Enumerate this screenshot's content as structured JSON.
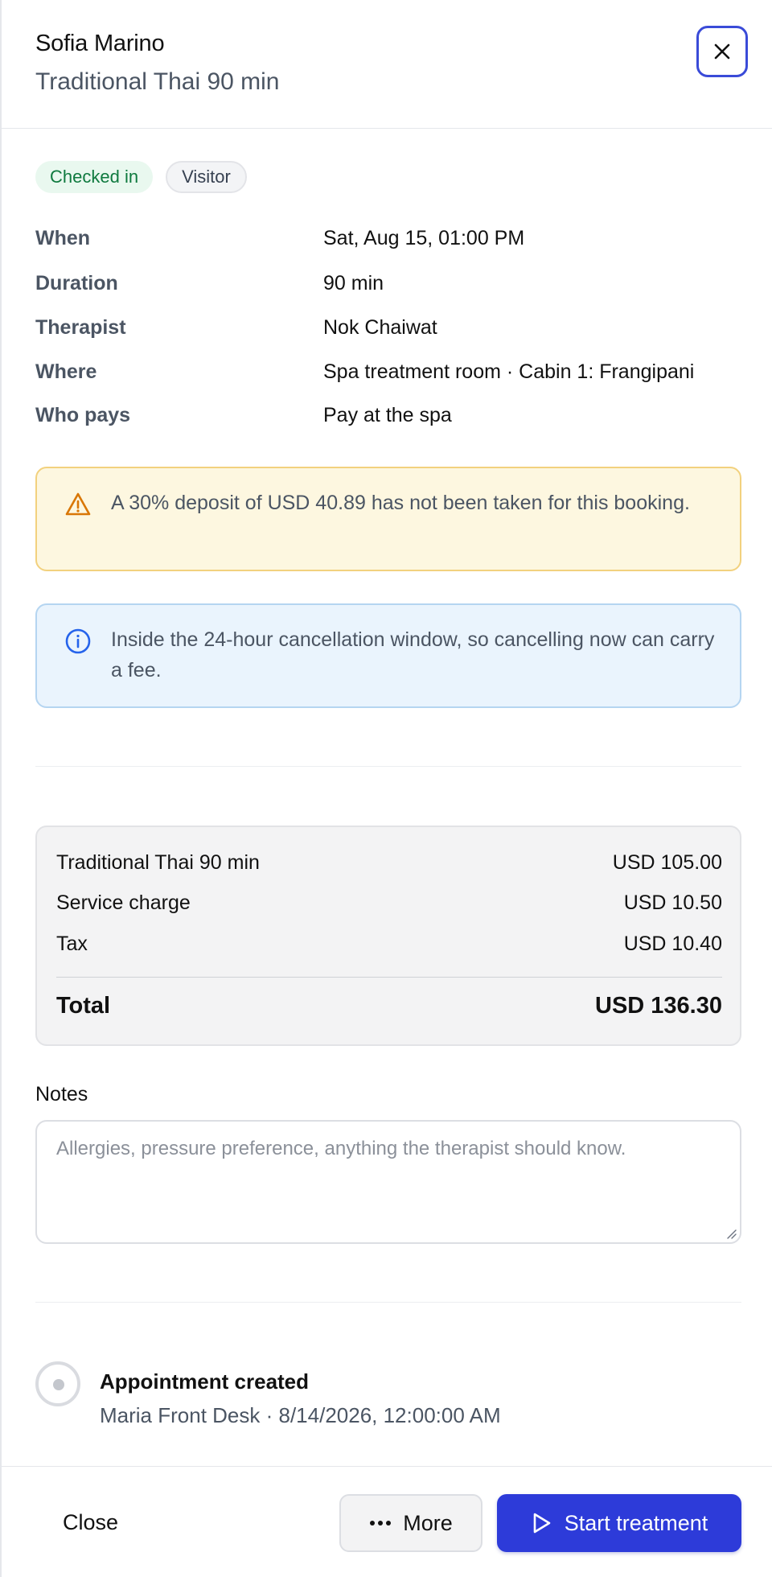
{
  "header": {
    "guest_name": "Sofia Marino",
    "service": "Traditional Thai 90 min",
    "close_icon": "close-icon"
  },
  "chips": [
    {
      "label": "Checked in",
      "color": "#0f7a3f"
    },
    {
      "label": "Visitor",
      "color": "#374151"
    }
  ],
  "details": [
    {
      "label": "When",
      "value": "Sat, Aug 15, 01:00 PM"
    },
    {
      "label": "Duration",
      "value": "90 min"
    },
    {
      "label": "Therapist",
      "value": "Nok Chaiwat"
    },
    {
      "label": "Where",
      "value": "Spa treatment room · Cabin 1: Frangipani"
    },
    {
      "label": "Who pays",
      "value": "Pay at the spa"
    }
  ],
  "alerts": {
    "deposit": {
      "icon": "warning-icon",
      "text": "A 30% deposit of USD 40.89 has not been taken for this booking."
    },
    "cancellation": {
      "icon": "info-icon",
      "text": "Inside the 24-hour cancellation window, so cancelling now can carry a fee."
    }
  },
  "summary": {
    "lines": [
      {
        "label": "Traditional Thai 90 min",
        "amount": "USD 105.00"
      },
      {
        "label": "Service charge",
        "amount": "USD 10.50"
      },
      {
        "label": "Tax",
        "amount": "USD 10.40"
      }
    ],
    "total_label": "Total",
    "total_amount": "USD 136.30"
  },
  "notes": {
    "label": "Notes",
    "placeholder": "Allergies, pressure preference, anything the therapist should know.",
    "value": ""
  },
  "timeline": [
    {
      "title": "Appointment created",
      "meta": "Maria Front Desk · 8/14/2026, 12:00:00 AM"
    }
  ],
  "footer": {
    "close_label": "Close",
    "more_label": "More",
    "start_label": "Start treatment"
  },
  "colors": {
    "accent": "#2d3bd9",
    "warning": "#d97706",
    "info": "#2563eb"
  }
}
